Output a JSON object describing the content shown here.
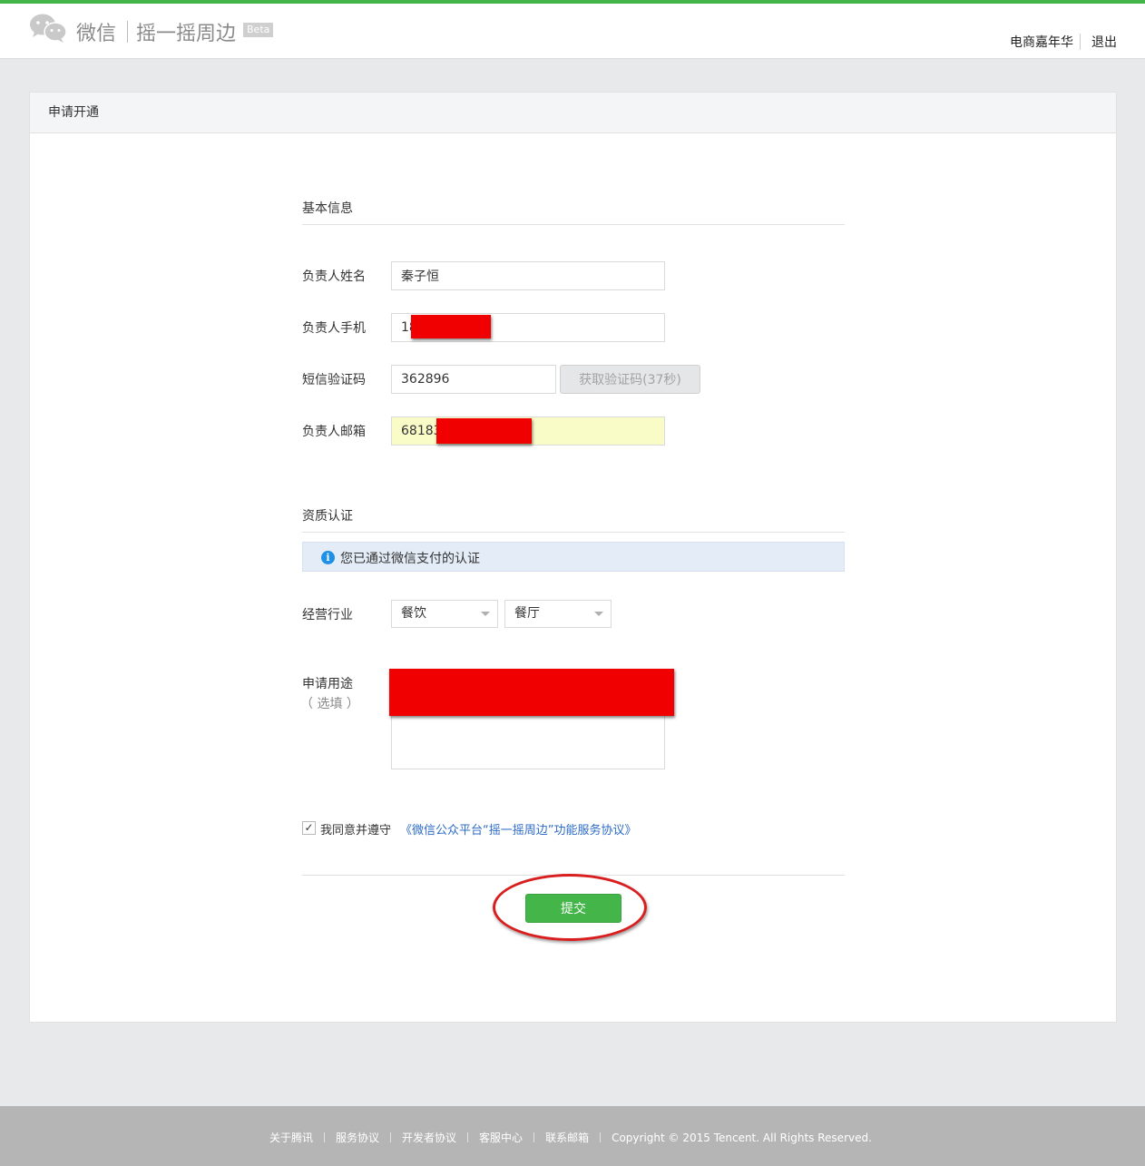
{
  "header": {
    "brand": "微信",
    "product": "摇一摇周边",
    "beta": "Beta",
    "user": "电商嘉年华",
    "logout": "退出"
  },
  "card": {
    "title": "申请开通"
  },
  "basic": {
    "title": "基本信息",
    "name_label": "负责人姓名",
    "name_value": "秦子恒",
    "phone_label": "负责人手机",
    "phone_value": "18",
    "code_label": "短信验证码",
    "code_value": "362896",
    "code_button": "获取验证码(37秒)",
    "email_label": "负责人邮箱",
    "email_value": "68183"
  },
  "qualification": {
    "title": "资质认证",
    "notice": "您已通过微信支付的认证",
    "industry_label": "经营行业",
    "industry_primary": "餐饮",
    "industry_secondary": "餐厅",
    "purpose_label": "申请用途",
    "purpose_optional": "（ 选填 ）"
  },
  "agreement": {
    "text": "我同意并遵守",
    "link": "《微信公众平台“摇一摇周边”功能服务协议》",
    "checked": true
  },
  "submit_label": "提交",
  "footer": {
    "links": [
      "关于腾讯",
      "服务协议",
      "开发者协议",
      "客服中心",
      "联系邮箱"
    ],
    "copyright": "Copyright © 2015 Tencent. All Rights Reserved."
  },
  "colors": {
    "accent": "#44b549",
    "link": "#2d6bc7",
    "redaction": "#f00000"
  }
}
